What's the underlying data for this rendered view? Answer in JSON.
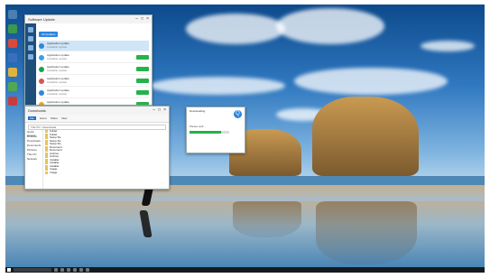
{
  "left_app": {
    "title": "Software Update",
    "tab": "All Updates",
    "rows": [
      {
        "name": "Application update",
        "detail": "Available update",
        "size": "",
        "version": "",
        "icon_color": "#2e86de",
        "action": ""
      },
      {
        "name": "Application update",
        "detail": "Available update",
        "size": "",
        "version": "",
        "icon_color": "#3aa0e8",
        "action": ""
      },
      {
        "name": "Application update",
        "detail": "Available update",
        "size": "",
        "version": "",
        "icon_color": "#1aa34a",
        "action": ""
      },
      {
        "name": "Application update",
        "detail": "Available update",
        "size": "",
        "version": "",
        "icon_color": "#d9534f",
        "action": ""
      },
      {
        "name": "Application update",
        "detail": "Available update",
        "size": "",
        "version": "",
        "icon_color": "#2e86de",
        "action": ""
      },
      {
        "name": "Application update",
        "detail": "Available update",
        "size": "",
        "version": "",
        "icon_color": "#f0a020",
        "action": ""
      }
    ]
  },
  "explorer": {
    "title": "Downloads",
    "ribbon": [
      "File",
      "Home",
      "Share",
      "View"
    ],
    "address": "This PC › Downloads",
    "nav_items": [
      "Quick access",
      "Desktop",
      "Downloads",
      "Documents",
      "Pictures",
      "This PC",
      "Network"
    ],
    "files": [
      {
        "name": "Folder",
        "date": ""
      },
      {
        "name": "Folder",
        "date": ""
      },
      {
        "name": "Setup file",
        "date": ""
      },
      {
        "name": "Setup file",
        "date": ""
      },
      {
        "name": "Setup file",
        "date": ""
      },
      {
        "name": "Document",
        "date": ""
      },
      {
        "name": "Document",
        "date": ""
      },
      {
        "name": "Archive",
        "date": ""
      },
      {
        "name": "Archive",
        "date": ""
      },
      {
        "name": "Installer",
        "date": ""
      },
      {
        "name": "Installer",
        "date": ""
      },
      {
        "name": "Installer",
        "date": ""
      },
      {
        "name": "Image",
        "date": ""
      },
      {
        "name": "Image",
        "date": ""
      }
    ]
  },
  "download_dialog": {
    "title": "Downloading",
    "status": "Please wait...",
    "progress": 0.8,
    "logo_letter": "Q"
  },
  "taskbar": {
    "time": "",
    "date": ""
  },
  "colors": {
    "accent": "#2e86de",
    "green": "#24b34b",
    "taskbar": "#141a20"
  }
}
